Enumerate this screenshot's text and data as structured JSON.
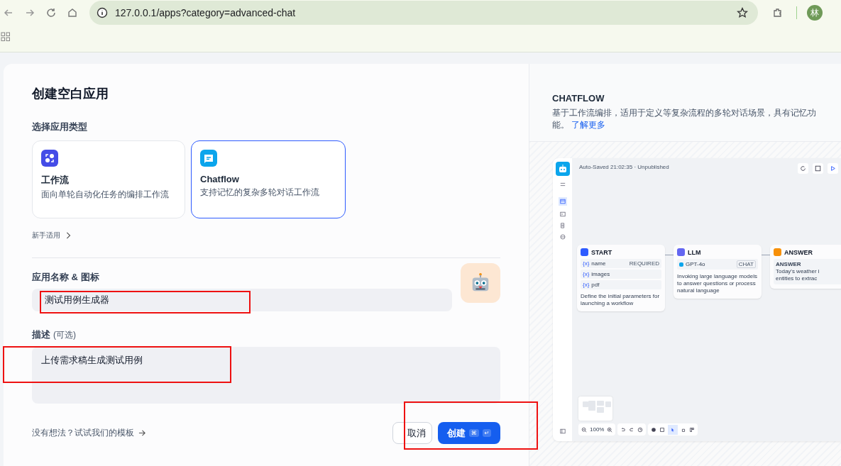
{
  "browser": {
    "url": "127.0.0.1/apps?category=advanced-chat",
    "profile": "林"
  },
  "dialog": {
    "title": "创建空白应用",
    "type_label": "选择应用类型",
    "app_types": [
      {
        "kind": "workflow",
        "name": "工作流",
        "description": "面向单轮自动化任务的编排工作流",
        "selected": false
      },
      {
        "kind": "chatflow",
        "name": "Chatflow",
        "description": "支持记忆的复杂多轮对话工作流",
        "selected": true
      }
    ],
    "beginner_link": "新手适用",
    "name_label": "应用名称 & 图标",
    "name_value": "测试用例生成器",
    "desc_label": "描述",
    "desc_optional": "(可选)",
    "desc_value": "上传需求稿生成测试用例",
    "template_link": "没有想法？试试我们的模板",
    "cancel": "取消",
    "create": "创建",
    "create_keys": [
      "⌘",
      "↵"
    ]
  },
  "preview": {
    "title": "CHATFLOW",
    "description": "基于工作流编排，适用于定义等复杂流程的多轮对话场景，具有记忆功能。",
    "learn_more": "了解更多",
    "canvas": {
      "status": "Auto-Saved 21:02:35 · Unpublished",
      "zoom": "100%",
      "nodes": [
        {
          "kind": "start",
          "title": "START",
          "vars": [
            {
              "marker": "{x}",
              "name": "name",
              "tag": "REQUIRED"
            },
            {
              "marker": "{x}",
              "name": "images"
            },
            {
              "marker": "{x}",
              "name": "pdf"
            }
          ],
          "text": "Define the initial parameters for launching a workflow"
        },
        {
          "kind": "llm",
          "title": "LLM",
          "model": "GPT-4o",
          "mode": "CHAT",
          "text": "Invoking large language models to answer questions or process natural language"
        },
        {
          "kind": "answer",
          "title": "ANSWER",
          "label": "ANSWER",
          "lines": [
            "Today's weather i",
            "entities to extrac"
          ]
        }
      ]
    }
  }
}
